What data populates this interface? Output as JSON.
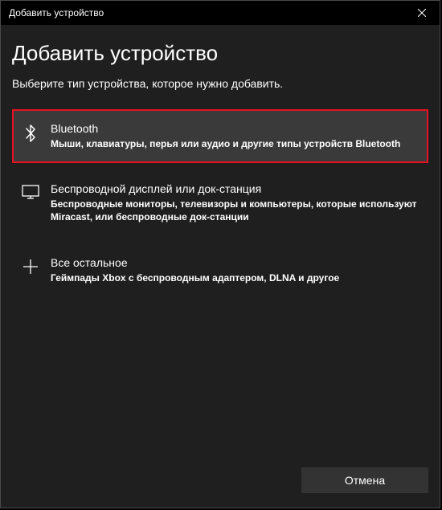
{
  "titlebar": {
    "text": "Добавить устройство"
  },
  "heading": "Добавить устройство",
  "subheading": "Выберите тип устройства, которое нужно добавить.",
  "options": [
    {
      "title": "Bluetooth",
      "desc": "Мыши, клавиатуры, перья или аудио и другие типы устройств Bluetooth"
    },
    {
      "title": "Беспроводной дисплей или док-станция",
      "desc": "Беспроводные мониторы, телевизоры и компьютеры, которые используют Miracast, или беспроводные док-станции"
    },
    {
      "title": "Все остальное",
      "desc": "Геймпады Xbox с беспроводным адаптером, DLNA и другое"
    }
  ],
  "footer": {
    "cancel_label": "Отмена"
  }
}
